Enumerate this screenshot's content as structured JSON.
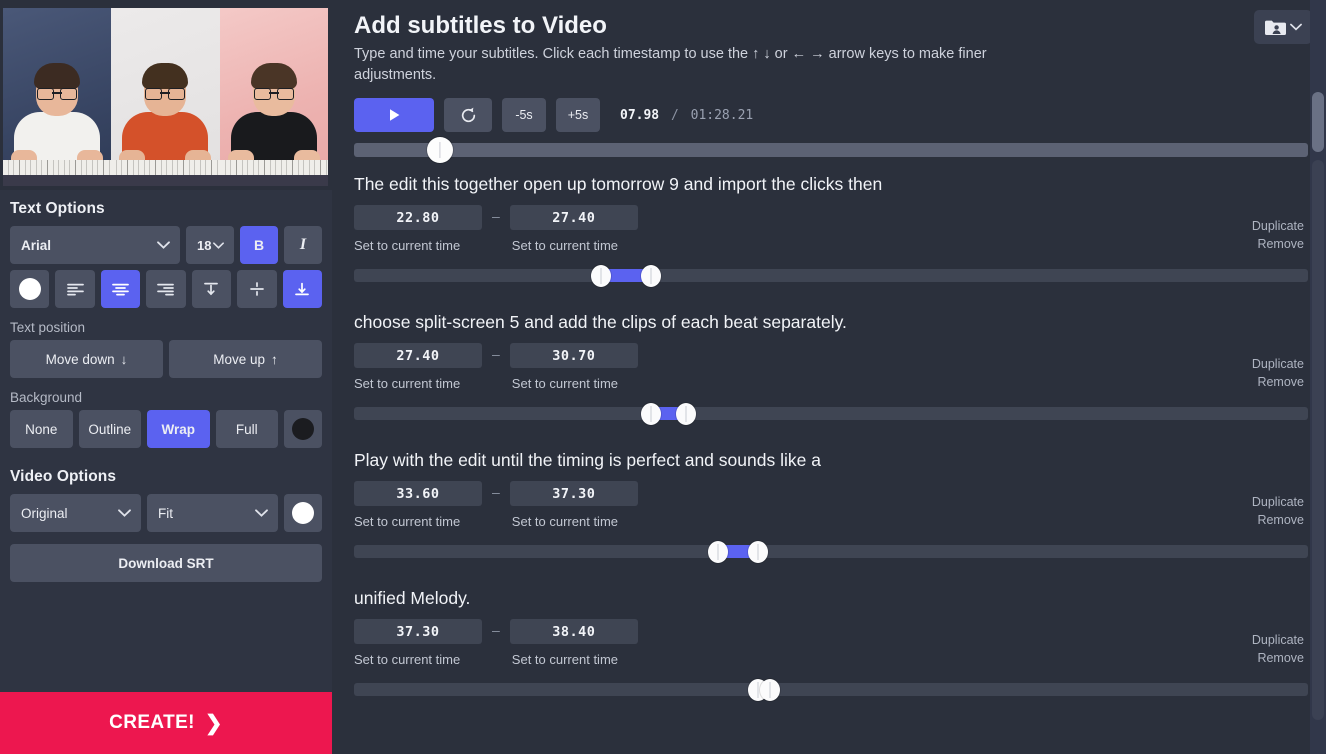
{
  "app": {
    "accent": "#5b62f0",
    "create_color": "#ed174f",
    "panel_bg": "#2f3442",
    "main_bg": "#2b303c"
  },
  "preview": {
    "name": "video-preview",
    "layout": "split-screen-3"
  },
  "sidebar": {
    "text_options": {
      "heading": "Text Options",
      "font_family": "Arial",
      "font_size": "18",
      "bold_label": "B",
      "italic_label": "I",
      "bold_active": true,
      "italic_active": false,
      "color": "#ffffff",
      "align_active": "center",
      "valign_active": "bottom",
      "icons": [
        "text-color-swatch",
        "align-left-icon",
        "align-center-icon",
        "align-right-icon",
        "valign-top-icon",
        "valign-middle-icon",
        "valign-bottom-icon"
      ]
    },
    "text_position": {
      "heading": "Text position",
      "move_down": "Move down",
      "move_down_arrow": "↓",
      "move_up": "Move up",
      "move_up_arrow": "↑"
    },
    "background": {
      "heading": "Background",
      "options": [
        "None",
        "Outline",
        "Wrap",
        "Full"
      ],
      "active": "Wrap",
      "color": "#1b1c20"
    },
    "video_options": {
      "heading": "Video Options",
      "quality": "Original",
      "fit": "Fit",
      "color": "#ffffff",
      "download_srt": "Download SRT"
    },
    "create_button": "CREATE!",
    "create_arrow": "❯"
  },
  "header": {
    "title": "Add subtitles to Video",
    "help_text": "Type and time your subtitles. Click each timestamp to use the ↑ ↓ or ← → arrow keys to make finer adjustments.",
    "account_icon": "folder-user-icon",
    "account_chevron": "chevron-down-icon"
  },
  "player": {
    "play_icon": "play-icon",
    "restart_icon": "restart-icon",
    "back_label": "-5s",
    "forward_label": "+5s",
    "current_time": "07.98",
    "separator": "/",
    "total_time": "01:28.21",
    "progress_percent": 9
  },
  "labels": {
    "set_to_current_time": "Set to current time",
    "duplicate": "Duplicate",
    "remove": "Remove",
    "time_dash": "–"
  },
  "subtitles": [
    {
      "text": "The edit this together open up tomorrow 9 and import the clicks then",
      "start": "22.80",
      "end": "27.40",
      "range_start_percent": 25.9,
      "range_end_percent": 31.1
    },
    {
      "text": "choose split-screen 5 and add the clips of each beat separately.",
      "start": "27.40",
      "end": "30.70",
      "range_start_percent": 31.1,
      "range_end_percent": 34.8
    },
    {
      "text": "Play with the edit until the timing is perfect and sounds like a",
      "start": "33.60",
      "end": "37.30",
      "range_start_percent": 38.2,
      "range_end_percent": 42.4
    },
    {
      "text": "unified Melody.",
      "start": "37.30",
      "end": "38.40",
      "range_start_percent": 42.4,
      "range_end_percent": 43.6
    }
  ]
}
